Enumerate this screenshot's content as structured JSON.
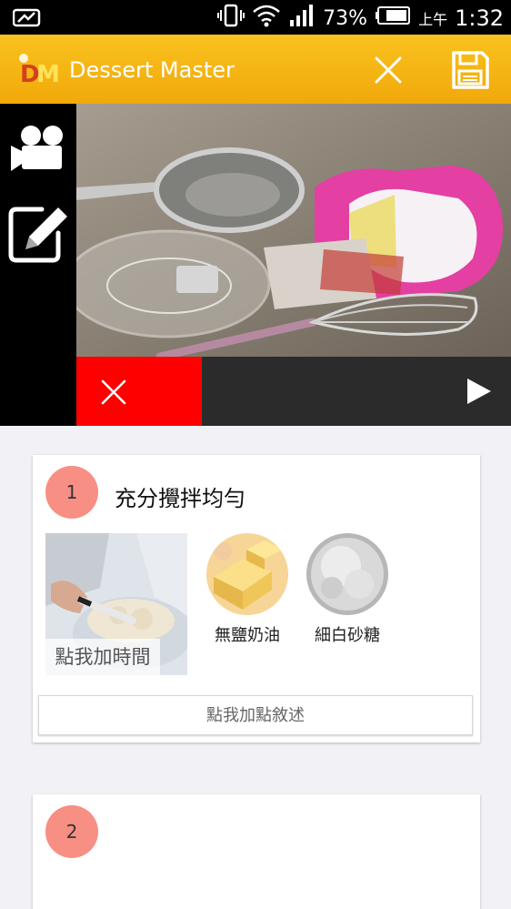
{
  "status_bar": {
    "battery_percent": "73%",
    "ampm": "上午",
    "time": "1:32"
  },
  "app_bar": {
    "logo_text": "DM",
    "title": "Dessert Master",
    "close_icon": "close-icon",
    "save_icon": "save-icon",
    "accent_color": "#f5b514"
  },
  "media": {
    "side_tools": [
      "video-camera-icon",
      "edit-icon"
    ],
    "delete_icon": "close-icon",
    "play_icon": "play-icon",
    "delete_color": "#ff0000"
  },
  "steps": [
    {
      "number": "1",
      "title": "充分攪拌均勻",
      "add_time_label": "點我加時間",
      "ingredients": [
        {
          "name": "無鹽奶油",
          "icon": "butter-image"
        },
        {
          "name": "細白砂糖",
          "icon": "sugar-image"
        }
      ],
      "add_description_label": "點我加點敘述"
    },
    {
      "number": "2"
    }
  ]
}
